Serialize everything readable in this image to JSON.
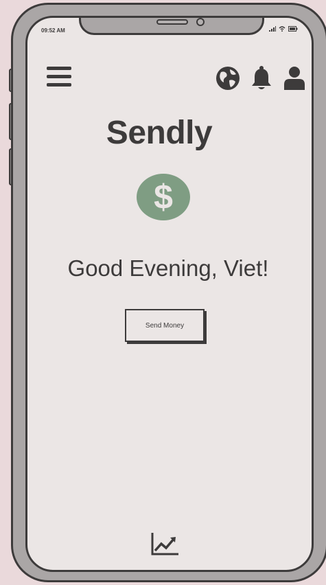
{
  "status_bar": {
    "time": "09:52 AM",
    "icons": [
      "signal-icon",
      "wifi-icon",
      "battery-icon"
    ]
  },
  "header": {
    "menu_icon": "hamburger-menu-icon",
    "icons": [
      "globe-icon",
      "bell-icon",
      "user-icon"
    ]
  },
  "brand": {
    "title": "Sendly",
    "logo_icon": "dollar-coin-icon",
    "logo_color": "#7f9d83"
  },
  "main": {
    "greeting": "Good Evening, Viet!",
    "send_button_label": "Send Money"
  },
  "footer": {
    "icon": "trending-chart-icon"
  },
  "colors": {
    "ink": "#3d3b3b",
    "screen": "#ebe6e5",
    "frame": "#aaa6a6",
    "backdrop": "#ead9db"
  }
}
